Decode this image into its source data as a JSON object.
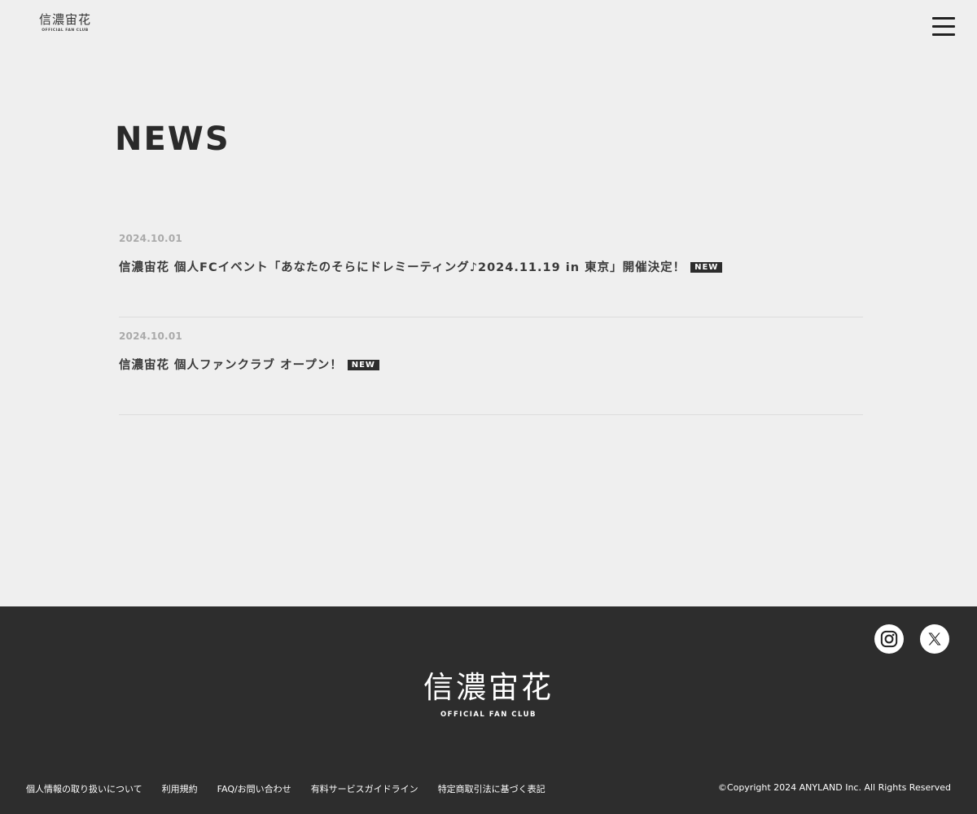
{
  "header": {
    "logo_kanji": "信濃宙花",
    "logo_sub": "OFFICIAL FAN CLUB",
    "menu_icon": "hamburger-menu-icon"
  },
  "page": {
    "title": "NEWS"
  },
  "news": [
    {
      "date": "2024.10.01",
      "title": "信濃宙花 個人FCイベント「あなたのそらにドレミーティング♪2024.11.19 in 東京」開催決定！",
      "badge": "NEW"
    },
    {
      "date": "2024.10.01",
      "title": "信濃宙花 個人ファンクラブ オープン！",
      "badge": "NEW"
    }
  ],
  "footer": {
    "social": [
      {
        "name": "Instagram",
        "icon": "instagram-icon"
      },
      {
        "name": "X",
        "icon": "x-icon"
      }
    ],
    "logo_kanji": "信濃宙花",
    "logo_sub": "OFFICIAL FAN CLUB",
    "links": [
      "個人情報の取り扱いについて",
      "利用規約",
      "FAQ/お問い合わせ",
      "有料サービスガイドライン",
      "特定商取引法に基づく表記"
    ],
    "copyright": "©Copyright 2024 ANYLAND Inc. All Rights Reserved"
  },
  "colors": {
    "background": "#efefef",
    "footer_bg": "#2d2d2d",
    "text": "#2d2d2d",
    "date": "#aaaaaa",
    "badge_bg": "#2d2d2d"
  }
}
